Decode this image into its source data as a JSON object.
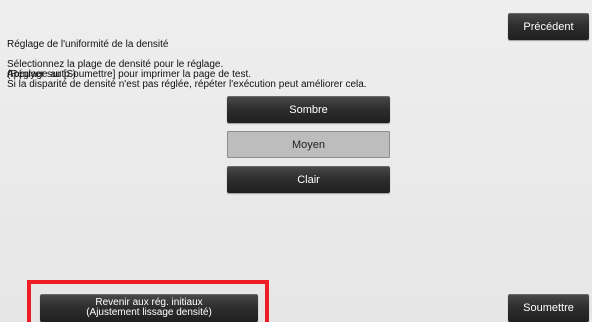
{
  "header": {
    "title_line1": "Réglage de l'uniformité de la densité",
    "title_line2": "(Réglage auto.)",
    "back_label": "Précédent"
  },
  "instructions": {
    "line1": "Sélectionnez la plage de densité pour le réglage.",
    "line2": "Appuyer sur [Soumettre] pour imprimer la page de test.",
    "line3": "Si la disparité de densité n'est pas réglée, répéter l'exécution peut améliorer cela."
  },
  "density_options": {
    "dark": "Sombre",
    "medium": "Moyen",
    "light": "Clair",
    "selected": "Moyen"
  },
  "footer": {
    "reset_line1": "Revenir aux rég. initiaux",
    "reset_line2": "(Ajustement lissage densité)",
    "submit_label": "Soumettre"
  },
  "colors": {
    "highlight": "#ee1c25",
    "button_dark": "#2f2f2f",
    "button_selected": "#bdbdbd"
  }
}
